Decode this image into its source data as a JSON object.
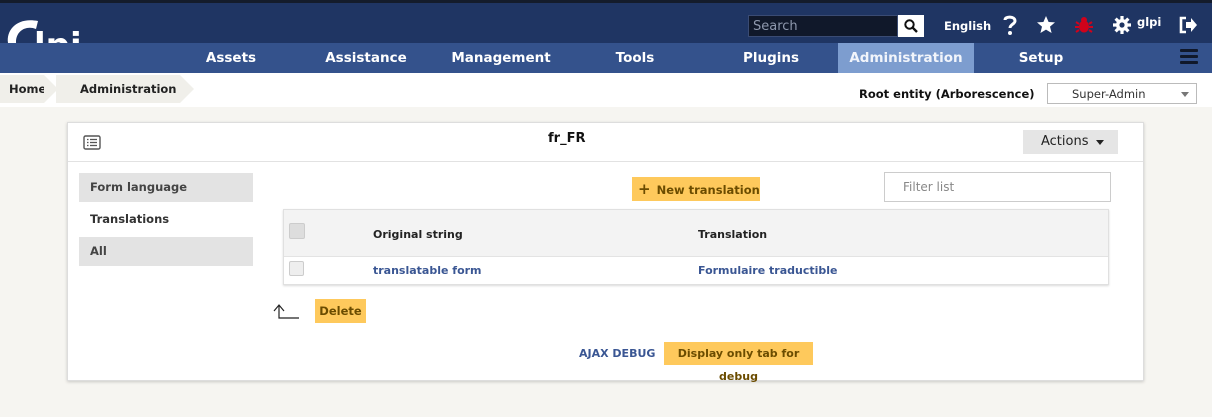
{
  "header": {
    "logo_text": "Glpi",
    "search_placeholder": "Search",
    "language": "English",
    "user": "glpi",
    "icons": [
      "search-icon",
      "help-icon",
      "star-icon",
      "bug-icon",
      "gear-icon",
      "logout-icon"
    ],
    "colors": {
      "topbar": "#1f3563",
      "nav": "#34528c",
      "nav_active": "#7d9dcf",
      "bug": "#d0021b"
    }
  },
  "nav": {
    "items": [
      {
        "label": "Assets"
      },
      {
        "label": "Assistance"
      },
      {
        "label": "Management"
      },
      {
        "label": "Tools"
      },
      {
        "label": "Plugins"
      },
      {
        "label": "Administration",
        "active": true
      },
      {
        "label": "Setup"
      }
    ]
  },
  "breadcrumb": {
    "items": [
      "Home",
      "Administration"
    ]
  },
  "entity": {
    "label": "Root entity (Arborescence)",
    "profile": "Super-Admin"
  },
  "card": {
    "title": "fr_FR",
    "actions_label": "Actions",
    "tabs": [
      {
        "label": "Form language"
      },
      {
        "label": "Translations",
        "active": true
      },
      {
        "label": "All"
      }
    ],
    "new_translation_label": "New translation",
    "filter_placeholder": "Filter list",
    "table": {
      "headers": [
        "Original string",
        "Translation"
      ],
      "rows": [
        {
          "original": "translatable form",
          "translation": "Formulaire traductible"
        }
      ]
    },
    "delete_label": "Delete",
    "ajax_debug_label": "AJAX DEBUG",
    "debug_tab_label": "Display only tab for debug",
    "accent": "#fec95c"
  }
}
